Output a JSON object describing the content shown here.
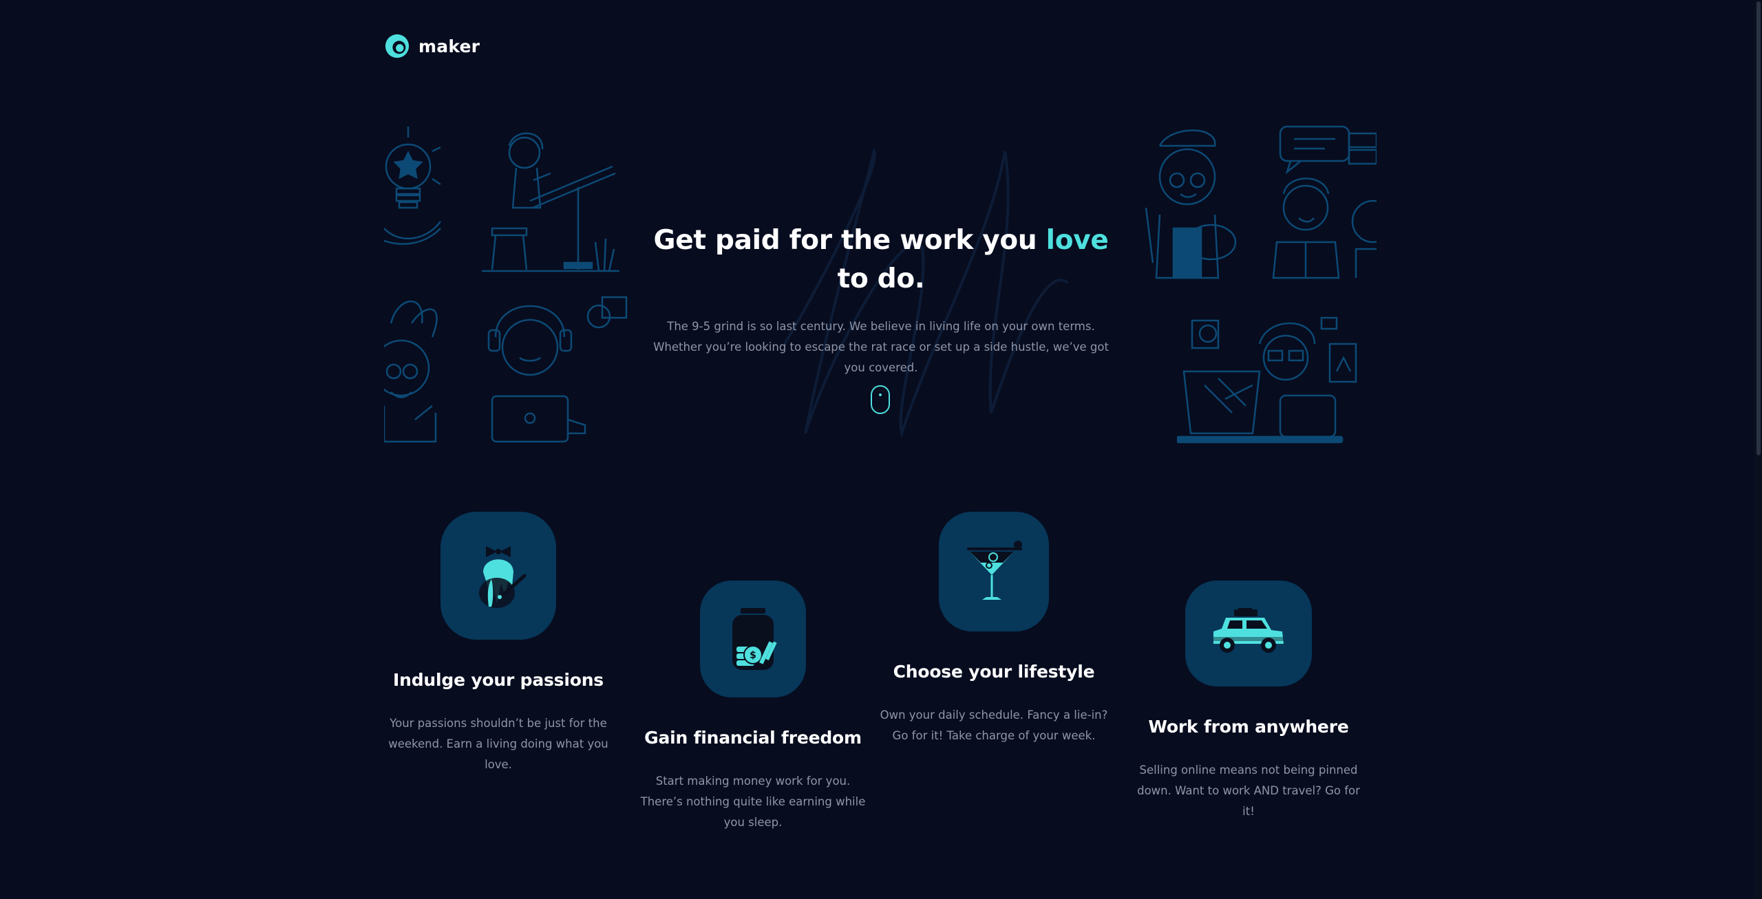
{
  "brand": {
    "name": "maker"
  },
  "hero": {
    "headline_before": "Get paid for the work you ",
    "headline_accent": "love",
    "headline_after": " to do.",
    "subtext": "The 9-5 grind is so last century. We believe in living life on your own terms. Whether you’re looking to escape the rat race or set up a side hustle, we’ve got you covered."
  },
  "features": [
    {
      "title": "Indulge your passions",
      "text": "Your passions shouldn’t be just for the weekend. Earn a living doing what you love.",
      "icon": "paint-splash-icon"
    },
    {
      "title": "Gain financial freedom",
      "text": "Start making money work for you. There’s nothing quite like earning while you sleep.",
      "icon": "money-jar-icon"
    },
    {
      "title": "Choose your lifestyle",
      "text": "Own your daily schedule. Fancy a lie-in? Go for it! Take charge of your week.",
      "icon": "cocktail-icon"
    },
    {
      "title": "Work from anywhere",
      "text": "Selling online means not being pinned down. Want to work AND travel? Go for it!",
      "icon": "car-icon"
    }
  ],
  "colors": {
    "background": "#070c1f",
    "accent": "#4ee0de",
    "tile": "#073759",
    "muted_text": "#8f96a8",
    "line_art": "#0c3a5e"
  }
}
